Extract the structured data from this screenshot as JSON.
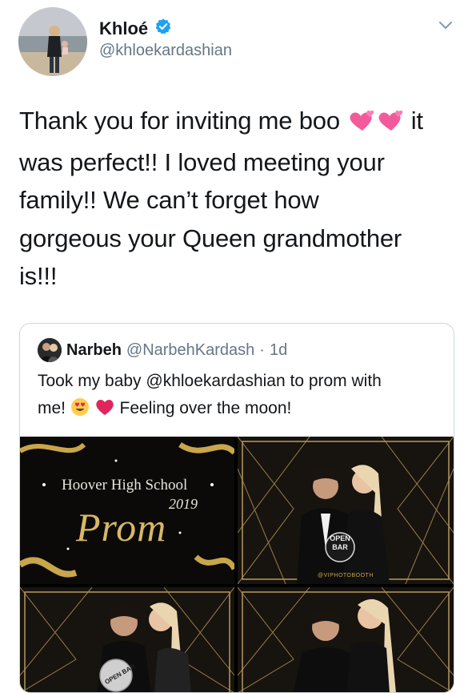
{
  "tweet": {
    "author_name": "Khloé",
    "handle": "@khloekardashian",
    "lines": [
      "Thank you for inviting me boo",
      "it",
      "was perfect!! I loved meeting your",
      "family!! We can’t forget how",
      "gorgeous your Queen grandmother",
      "is!!!"
    ],
    "verified_icon": "verified-badge-icon",
    "menu_icon": "chevron-down-icon"
  },
  "quoted": {
    "author_name": "Narbeh",
    "handle": "@NarbehKardash",
    "separator": "·",
    "time": "1d",
    "text_line1": "Took my baby @khloekardashian to prom with",
    "text_line2a": "me!",
    "text_line2b": "Feeling over the moon!"
  },
  "photo_strip": {
    "school": "Hoover High School",
    "year": "2019",
    "title": "Prom",
    "sign_line1": "OPEN",
    "sign_line2": "BAR",
    "footer": "@VIPHOTOBOOTH",
    "sign_small": "OPEN BAR"
  },
  "colors": {
    "accent": "#1da1f2",
    "muted": "#657786",
    "heart": "#e0245e",
    "gold": "#c9a64b"
  }
}
